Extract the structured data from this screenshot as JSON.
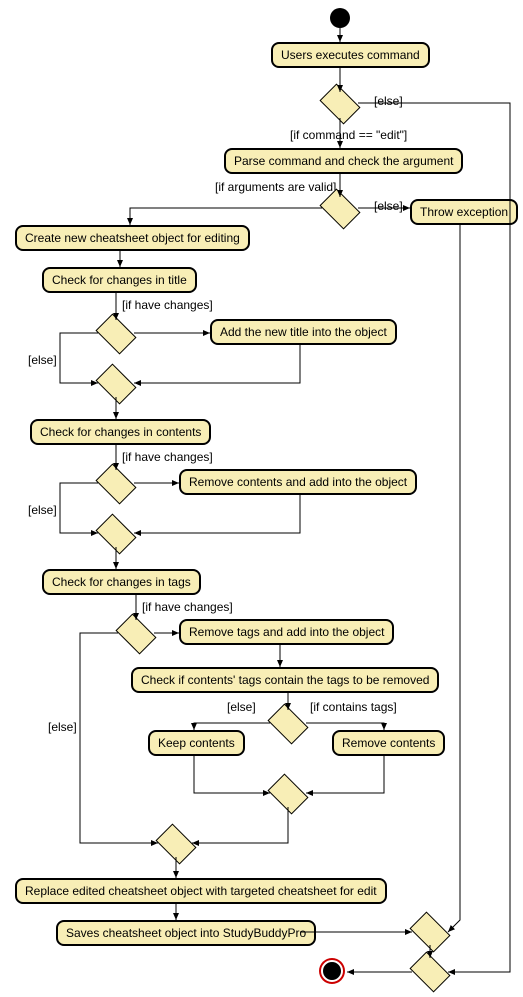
{
  "nodes": {
    "start": "Users executes command",
    "parse": "Parse command and check the argument",
    "create": "Create new cheatsheet object for editing",
    "throw": "Throw exception",
    "checkTitle": "Check for changes in title",
    "addTitle": "Add the new title into the object",
    "checkContents": "Check for changes in contents",
    "removeContents": "Remove contents and add into the object",
    "checkTags": "Check for changes in tags",
    "removeTags": "Remove tags and add into the object",
    "checkContain": "Check if contents' tags contain the tags to be removed",
    "keep": "Keep contents",
    "remove": "Remove contents",
    "replace": "Replace edited cheatsheet object with targeted cheatsheet for edit",
    "save": "Saves cheatsheet object into StudyBuddyPro"
  },
  "labels": {
    "else": "[else]",
    "ifEdit": "[if command == \"edit\"]",
    "ifValid": "[if arguments are valid]",
    "ifChanges": "[if have changes]",
    "ifContains": "[if contains tags]"
  }
}
